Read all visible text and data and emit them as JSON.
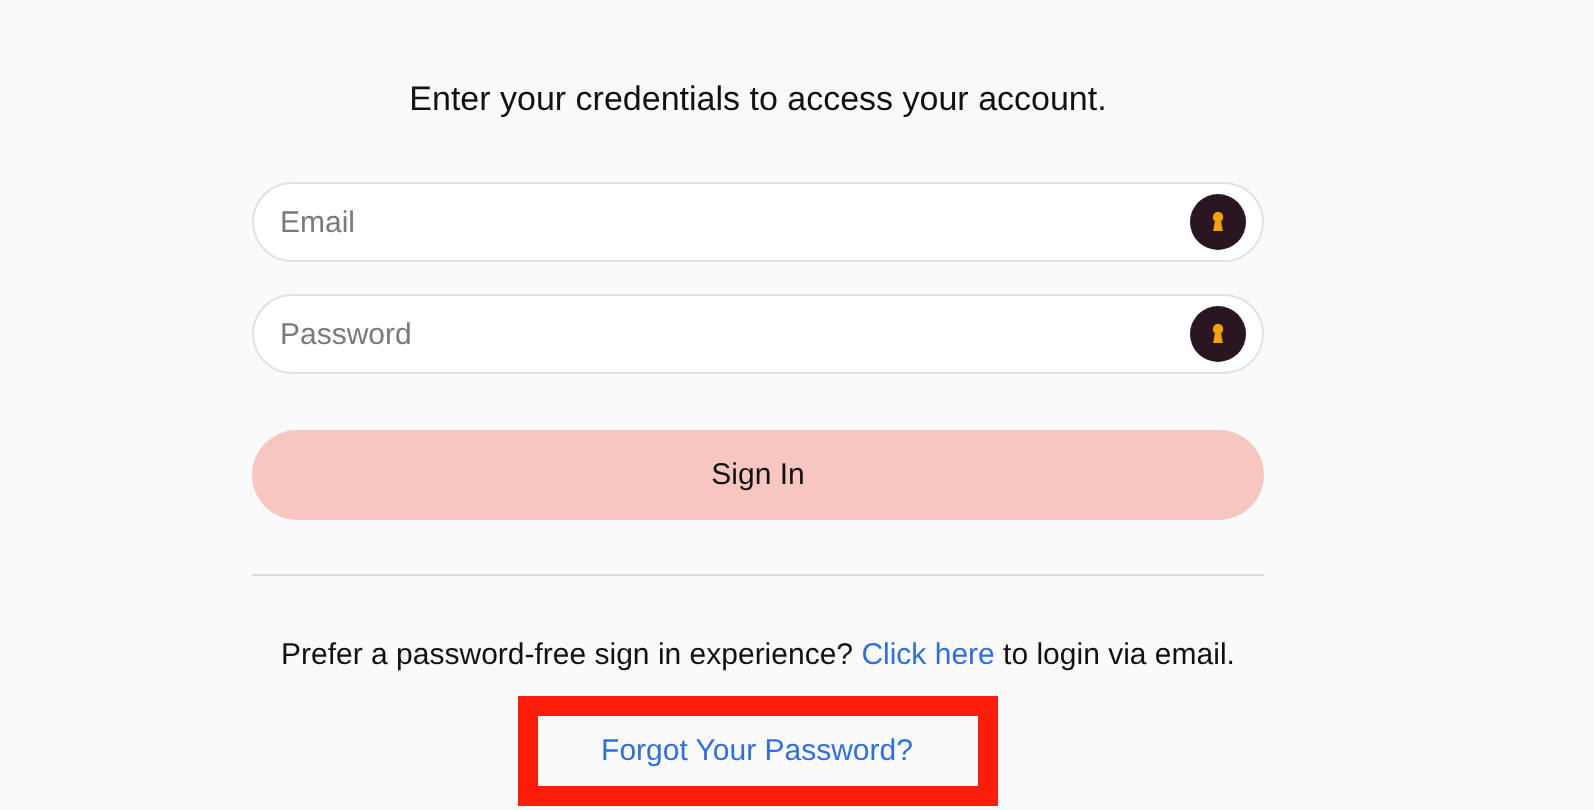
{
  "heading": "Enter your credentials to access your account.",
  "fields": [
    {
      "placeholder": "Email"
    },
    {
      "placeholder": "Password"
    }
  ],
  "submit": {
    "label": "Sign In"
  },
  "passwordless": {
    "before": "Prefer a password-free sign in experience?",
    "link": "Click here",
    "after": "to login via email."
  },
  "forgot": {
    "label": "Forgot Your Password?",
    "highlighted": true
  }
}
